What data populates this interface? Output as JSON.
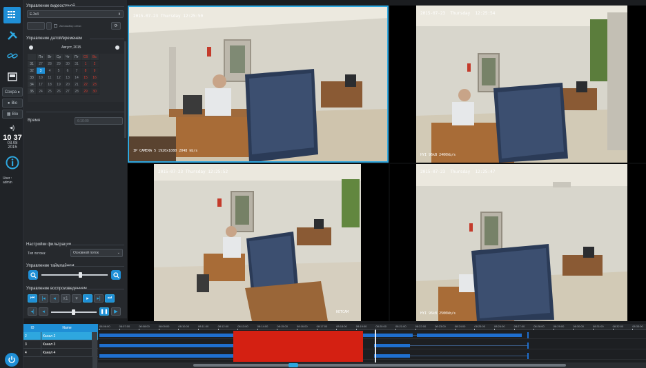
{
  "rail": {
    "clock_time": "10 37",
    "clock_date_1": "03.08",
    "clock_date_2": "2015",
    "user_label": "User :",
    "user_name": "admin",
    "save_label": "Сохра",
    "btn_a": "Bio",
    "btn_b": "Bio"
  },
  "panel": {
    "video_section": "Управление видеостеной",
    "video_value": "E-3x3",
    "auto_label": "Автовыбор сетки",
    "date_section": "Управление датой/временем",
    "month_label": "Август, 2015",
    "weekdays": [
      "Пн",
      "Вт",
      "Ср",
      "Чт",
      "Пт",
      "Сб",
      "Вс"
    ],
    "weeks": [
      "31",
      "32",
      "33",
      "34",
      "35"
    ],
    "days": [
      [
        "27",
        "28",
        "29",
        "30",
        "31",
        "1",
        "2"
      ],
      [
        "3",
        "4",
        "5",
        "6",
        "7",
        "8",
        "9"
      ],
      [
        "10",
        "11",
        "12",
        "13",
        "14",
        "15",
        "16"
      ],
      [
        "17",
        "18",
        "19",
        "20",
        "21",
        "22",
        "23"
      ],
      [
        "24",
        "25",
        "26",
        "27",
        "28",
        "29",
        "30"
      ]
    ],
    "time_label": "Время",
    "time_value": "6:10:00",
    "filter_section": "Настройки фильтрации",
    "stream_type_label": "Тип потока:",
    "stream_type_value": "Основной поток",
    "timeline_section": "Управление таймлайном",
    "playback_section": "Управление воспроизведением",
    "speed_value": "x1"
  },
  "cameras": [
    {
      "stamp": "2015-07-23 Thursday 12:25:50",
      "rate": "IP CAMERA  5 1920x1080 2048 kb/s",
      "name": ""
    },
    {
      "stamp": "2015-07-23  Thursday  12:25:54",
      "rate": "HYI 96kB 2400kb/s",
      "name": ""
    },
    {
      "stamp": "2015-07-23 Thursday 12:25:52",
      "rate": "",
      "name": "НЕТСАМ"
    },
    {
      "stamp": "2015-07-23  Thursday  12:25:47",
      "rate": "HYI 96kB 2500kb/s",
      "name": ""
    }
  ],
  "channels": {
    "col_id": "ID",
    "col_name": "Name",
    "rows": [
      {
        "id": "2",
        "name": "Канал 2"
      },
      {
        "id": "3",
        "name": "Канал 3"
      },
      {
        "id": "4",
        "name": "Канал 4"
      }
    ]
  },
  "timeline": {
    "ticks": [
      "08:06:00",
      "08:07:00",
      "08:08:00",
      "08:09:00",
      "08:10:00",
      "08:11:00",
      "08:12:00",
      "08:13:00",
      "08:14:00",
      "08:15:00",
      "08:16:00",
      "08:17:00",
      "08:18:00",
      "08:19:00",
      "08:20:00",
      "08:21:00",
      "08:22:00",
      "08:23:00",
      "08:24:00",
      "08:25:00",
      "08:26:00",
      "08:27:00",
      "08:28:00",
      "08:29:00",
      "08:30:00",
      "08:31:00",
      "08:32:00",
      "08:33:00"
    ]
  },
  "colors": {
    "accent": "#1f8fd6",
    "selection": "#d42012",
    "recording": "#1f6fcf"
  }
}
